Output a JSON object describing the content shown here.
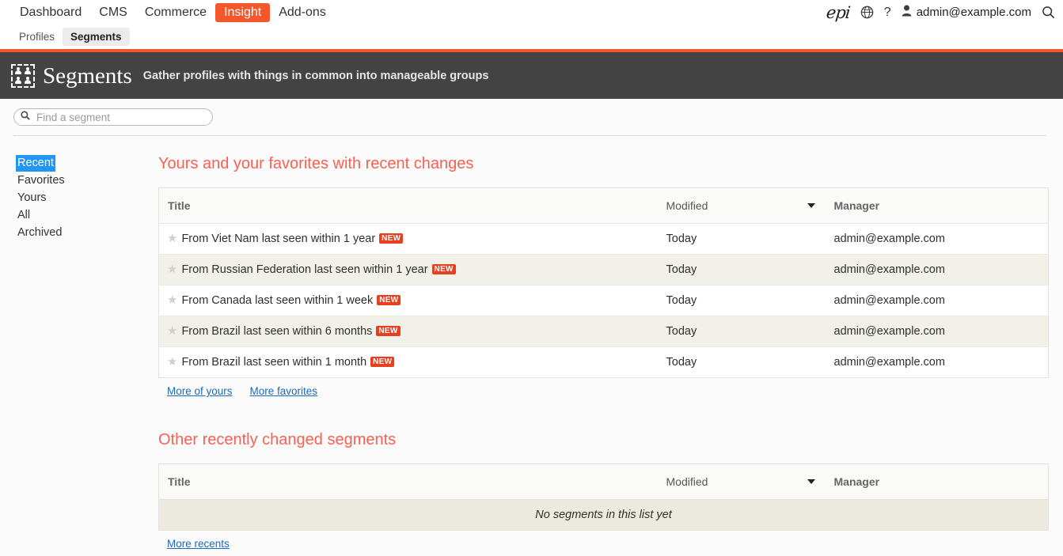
{
  "nav": {
    "main_items": [
      {
        "label": "Dashboard",
        "active": false
      },
      {
        "label": "CMS",
        "active": false
      },
      {
        "label": "Commerce",
        "active": false
      },
      {
        "label": "Insight",
        "active": true
      },
      {
        "label": "Add-ons",
        "active": false
      }
    ],
    "sub_items": [
      {
        "label": "Profiles",
        "active": false
      },
      {
        "label": "Segments",
        "active": true
      }
    ],
    "logo_text": "epi",
    "help_label": "?",
    "user_email": "admin@example.com",
    "icons": {
      "globe": "globe-icon",
      "help": "help-icon",
      "user": "user-icon",
      "search": "search-icon"
    }
  },
  "banner": {
    "title": "Segments",
    "description": "Gather profiles with things in common into manageable groups",
    "accent_color": "#f4572a",
    "background_color": "#434343"
  },
  "search": {
    "placeholder": "Find a segment",
    "value": ""
  },
  "sidebar": {
    "items": [
      {
        "label": "Recent",
        "selected": true
      },
      {
        "label": "Favorites",
        "selected": false
      },
      {
        "label": "Yours",
        "selected": false
      },
      {
        "label": "All",
        "selected": false
      },
      {
        "label": "Archived",
        "selected": false
      }
    ]
  },
  "sections": [
    {
      "heading": "Yours and your favorites with recent changes",
      "columns": {
        "title": "Title",
        "modified": "Modified",
        "manager": "Manager"
      },
      "sorted_by": "Modified",
      "sort_direction": "desc",
      "rows": [
        {
          "title": "From Viet Nam last seen within 1 year",
          "badge": "NEW",
          "modified": "Today",
          "manager": "admin@example.com"
        },
        {
          "title": "From Russian Federation last seen within 1 year",
          "badge": "NEW",
          "modified": "Today",
          "manager": "admin@example.com"
        },
        {
          "title": "From Canada last seen within 1 week",
          "badge": "NEW",
          "modified": "Today",
          "manager": "admin@example.com"
        },
        {
          "title": "From Brazil last seen within 6 months",
          "badge": "NEW",
          "modified": "Today",
          "manager": "admin@example.com"
        },
        {
          "title": "From Brazil last seen within 1 month",
          "badge": "NEW",
          "modified": "Today",
          "manager": "admin@example.com"
        }
      ],
      "empty_message": null,
      "links": [
        {
          "label": "More of yours"
        },
        {
          "label": "More favorites"
        }
      ]
    },
    {
      "heading": "Other recently changed segments",
      "columns": {
        "title": "Title",
        "modified": "Modified",
        "manager": "Manager"
      },
      "sorted_by": "Modified",
      "sort_direction": "desc",
      "rows": [],
      "empty_message": "No segments in this list yet",
      "links": [
        {
          "label": "More recents"
        }
      ]
    }
  ],
  "colors": {
    "accent_orange": "#f4572a",
    "heading_red": "#fa6052",
    "badge_red": "#e8401f",
    "link_blue": "#1a6bbf",
    "selection_blue": "#2196f3"
  }
}
